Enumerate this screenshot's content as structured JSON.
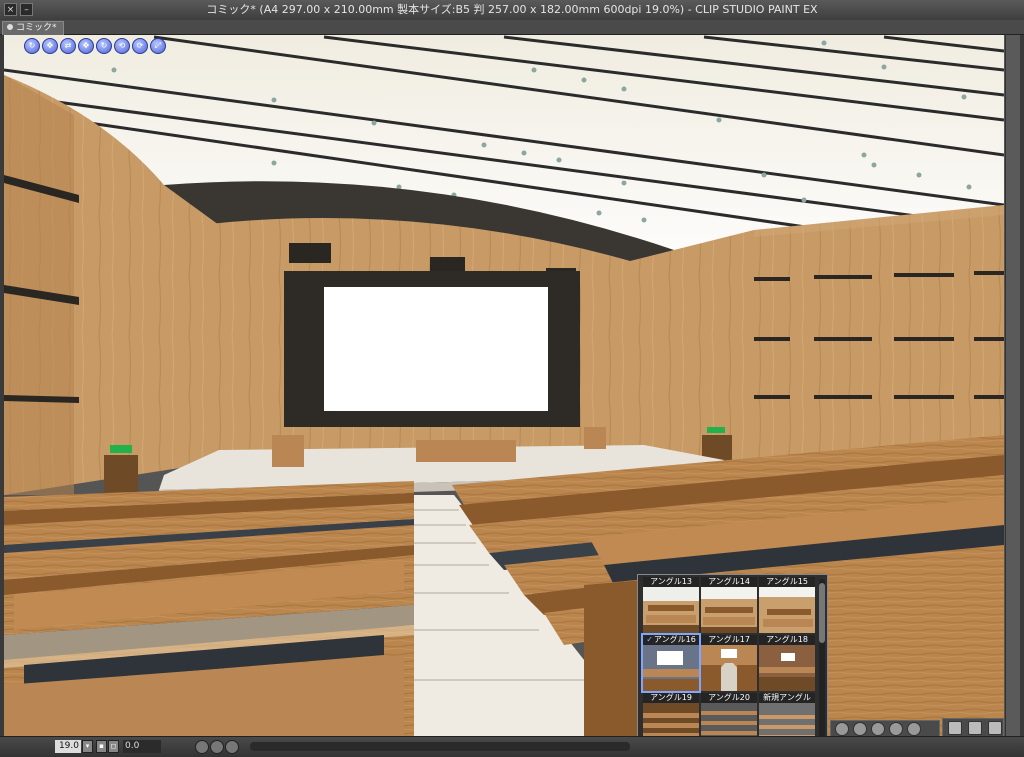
{
  "window": {
    "title": "コミック* (A4 297.00 x 210.00mm 製本サイズ:B5 判 257.00 x 182.00mm 600dpi 19.0%)  - CLIP STUDIO PAINT EX",
    "close_icon": "×",
    "minimize_icon": "–"
  },
  "tab": {
    "label": "コミック*"
  },
  "navigator_tools": [
    {
      "name": "rotate-camera-icon",
      "glyph": "↻"
    },
    {
      "name": "pan-camera-icon",
      "glyph": "✥"
    },
    {
      "name": "dolly-camera-icon",
      "glyph": "⇄"
    },
    {
      "name": "move-object-icon",
      "glyph": "✥"
    },
    {
      "name": "rotate-object-icon",
      "glyph": "↻"
    },
    {
      "name": "rotate-object-y-icon",
      "glyph": "⟲"
    },
    {
      "name": "rotate-object-x-icon",
      "glyph": "⟳"
    },
    {
      "name": "scale-object-icon",
      "glyph": "⤢"
    }
  ],
  "status": {
    "zoom": "19.0",
    "rotation": "0.0"
  },
  "angle_panel": {
    "items": [
      {
        "label": "アングル13",
        "selected": false
      },
      {
        "label": "アングル14",
        "selected": false
      },
      {
        "label": "アングル15",
        "selected": false
      },
      {
        "label": "アングル16",
        "selected": true,
        "check": "✓"
      },
      {
        "label": "アングル17",
        "selected": false
      },
      {
        "label": "アングル18",
        "selected": false
      },
      {
        "label": "アングル19",
        "selected": false
      },
      {
        "label": "アングル20",
        "selected": false
      },
      {
        "label": "新規アングル",
        "selected": false
      }
    ]
  },
  "colors": {
    "wood": "#b8844c",
    "wood_dark": "#8a5a2c",
    "ceiling": "#fbfbf6",
    "stage_floor": "#e8e4dc",
    "screen": "#ffffff",
    "screen_frame": "#2e2b27",
    "exit_sign": "#22b24c"
  }
}
